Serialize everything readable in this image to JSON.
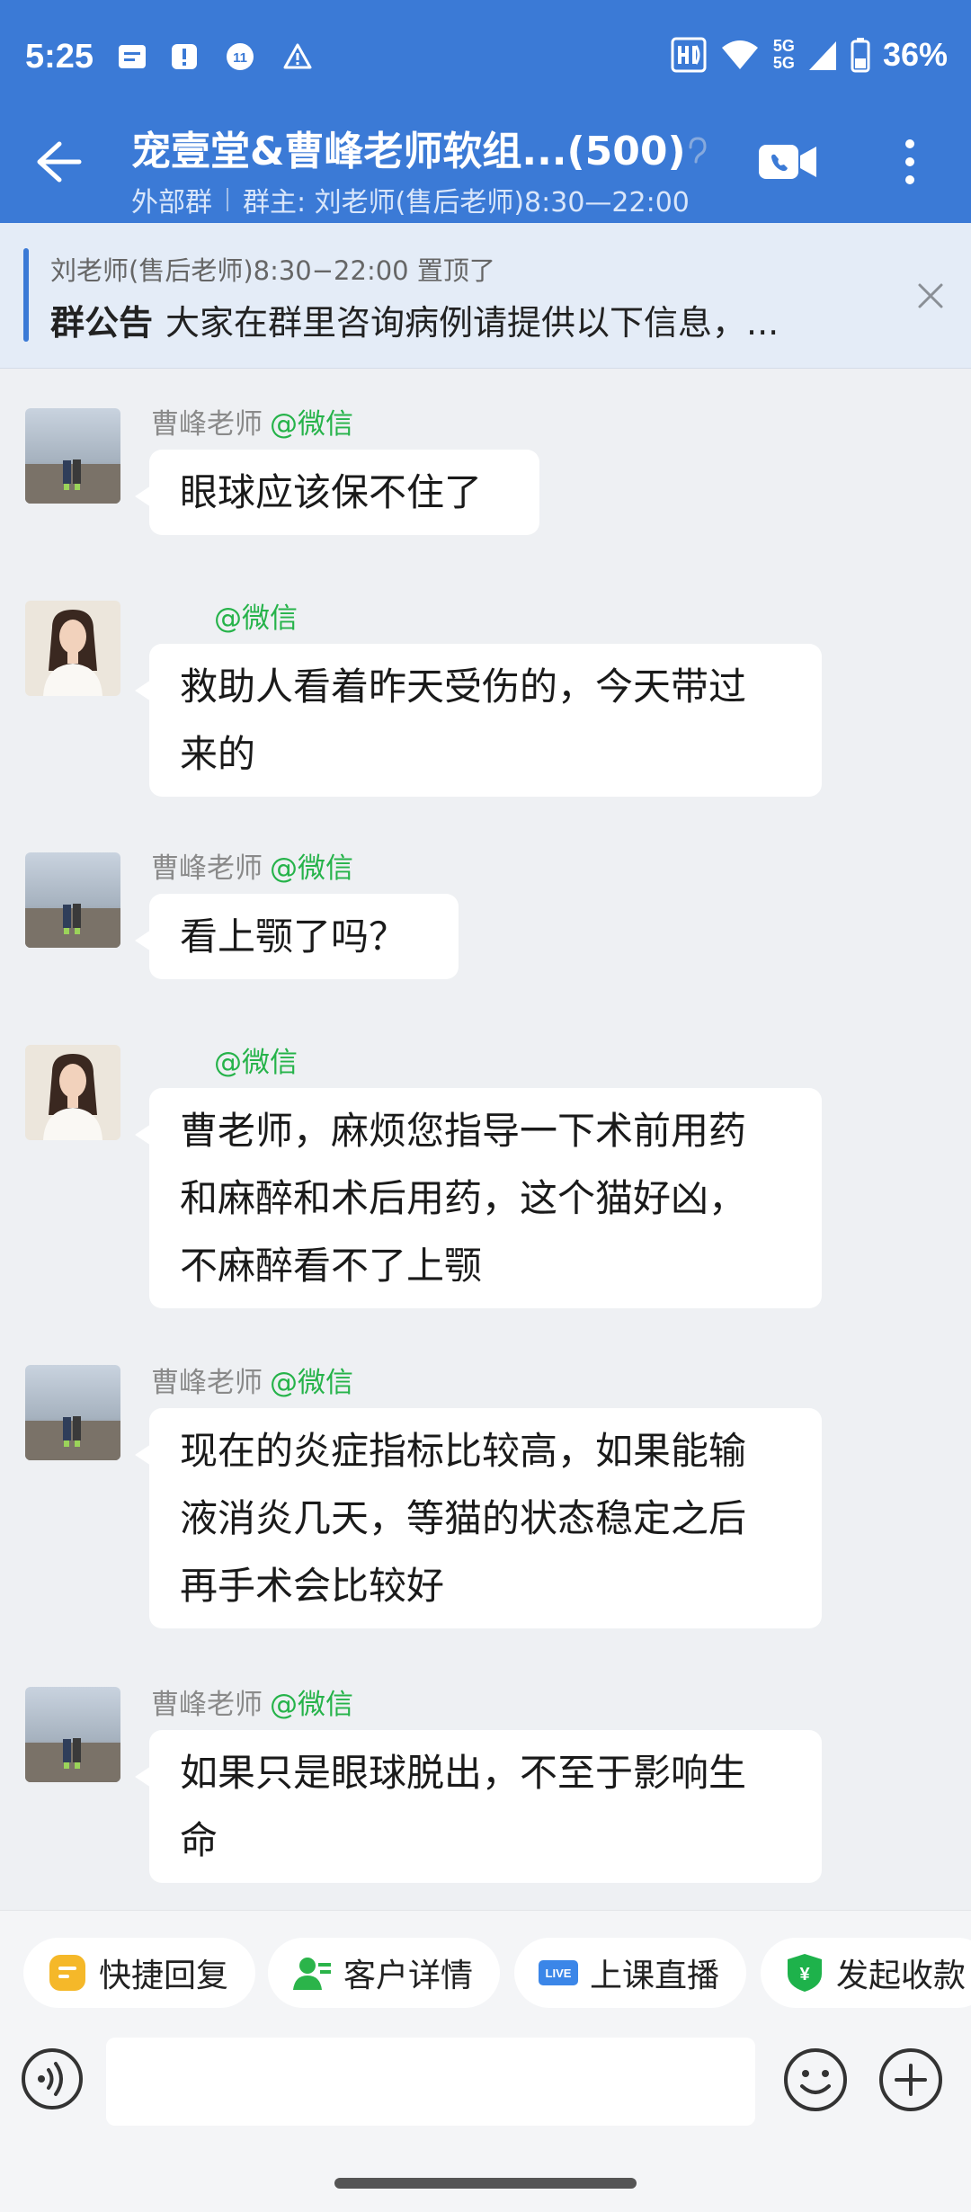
{
  "status_bar": {
    "time": "5:25",
    "notification_badge": "11",
    "network_5g_top": "5G",
    "network_5g_bottom": "5G",
    "battery": "36%"
  },
  "header": {
    "title": "宠壹堂&曹峰老师软组...(500)",
    "tag": "外部群",
    "owner": "群主: 刘老师(售后老师)8:30—22:00"
  },
  "announcement": {
    "pinned_by": "刘老师(售后老师)8:30−22:00 置顶了",
    "label": "群公告",
    "text": "大家在群里咨询病例请提供以下信息，..."
  },
  "messages": [
    {
      "sender": "曹峰老师",
      "source": "@微信",
      "lines": [
        "眼球应该保不住了"
      ],
      "avatar": "landscape"
    },
    {
      "sender": "",
      "source": "@微信",
      "lines": [
        "救助人看着昨天受伤的，今天带过",
        "来的"
      ],
      "avatar": "woman"
    },
    {
      "sender": "曹峰老师",
      "source": "@微信",
      "lines": [
        "看上颚了吗？"
      ],
      "avatar": "landscape"
    },
    {
      "sender": "",
      "source": "@微信",
      "lines": [
        "曹老师，麻烦您指导一下术前用药",
        "和麻醉和术后用药，这个猫好凶，",
        "不麻醉看不了上颚"
      ],
      "avatar": "woman"
    },
    {
      "sender": "曹峰老师",
      "source": "@微信",
      "lines": [
        "现在的炎症指标比较高，如果能输",
        "液消炎几天，等猫的状态稳定之后",
        "再手术会比较好"
      ],
      "avatar": "landscape"
    },
    {
      "sender": "曹峰老师",
      "source": "@微信",
      "lines": [
        "如果只是眼球脱出，不至于影响生",
        "命"
      ],
      "avatar": "landscape"
    }
  ],
  "quick_actions": [
    {
      "label": "快捷回复",
      "icon": "quick-reply-icon",
      "color": "#f5b829"
    },
    {
      "label": "客户详情",
      "icon": "customer-detail-icon",
      "color": "#2bb44a"
    },
    {
      "label": "上课直播",
      "icon": "live-icon",
      "color": "#3b86e8",
      "badge": "LIVE"
    },
    {
      "label": "发起收款",
      "icon": "payment-icon",
      "color": "#1eb24b",
      "badge": "¥"
    }
  ],
  "input": {
    "placeholder": ""
  },
  "colors": {
    "header": "#3b7ad6",
    "wechat_green": "#26b34a"
  }
}
